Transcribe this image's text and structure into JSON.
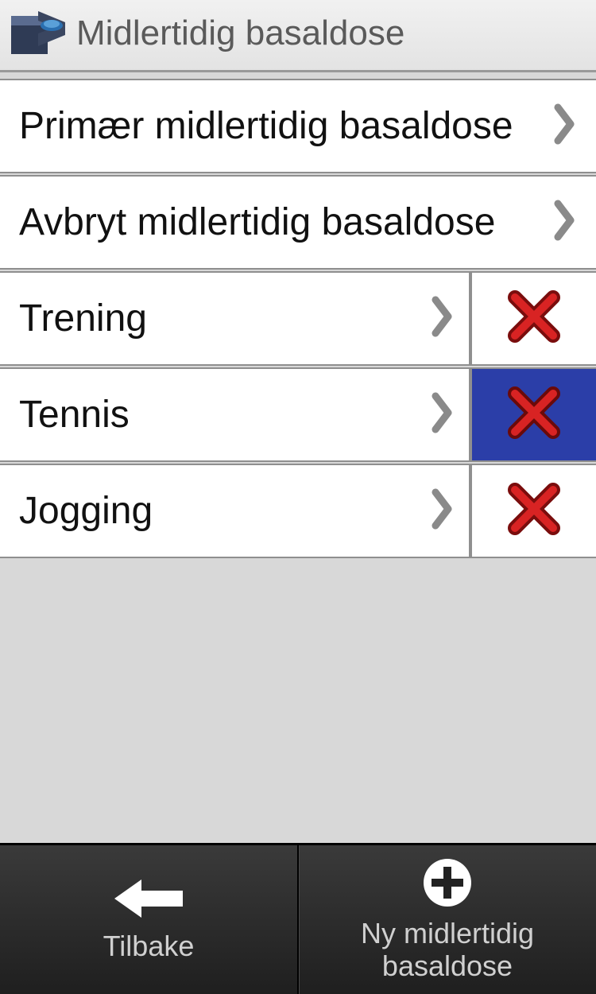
{
  "header": {
    "title": "Midlertidig basaldose"
  },
  "menu": {
    "primary": "Primær midlertidig basaldose",
    "cancel": "Avbryt midlertidig basaldose",
    "items": [
      {
        "label": "Trening",
        "selected": false
      },
      {
        "label": "Tennis",
        "selected": true
      },
      {
        "label": "Jogging",
        "selected": false
      }
    ]
  },
  "footer": {
    "back": "Tilbake",
    "new_line1": "Ny midlertidig",
    "new_line2": "basaldose"
  },
  "colors": {
    "selected_bg": "#2b3ea8",
    "x_red": "#c81e1e"
  }
}
